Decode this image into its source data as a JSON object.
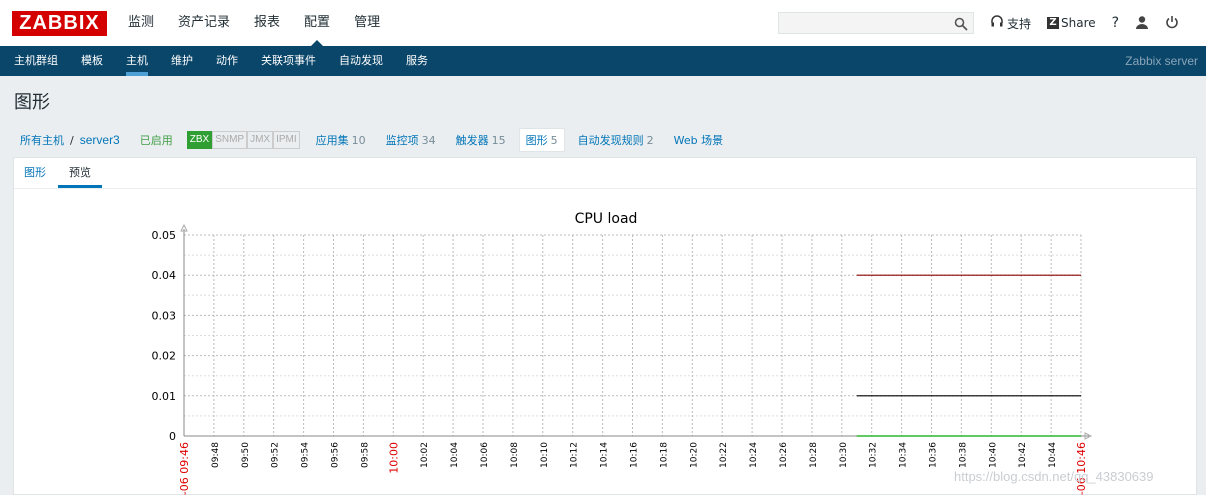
{
  "header": {
    "logo": "ZABBIX",
    "nav": [
      "监测",
      "资产记录",
      "报表",
      "配置",
      "管理"
    ],
    "active_nav": 3,
    "search_placeholder": "",
    "support_label": "支持",
    "share_label": "Share",
    "help_label": "?"
  },
  "subnav": {
    "items": [
      "主机群组",
      "模板",
      "主机",
      "维护",
      "动作",
      "关联项事件",
      "自动发现",
      "服务"
    ],
    "active": 2,
    "server_name": "Zabbix server"
  },
  "page_title": "图形",
  "breadcrumb": {
    "all_hosts": "所有主机",
    "separator": "/",
    "host": "server3",
    "status": "已启用",
    "badges": [
      "ZBX",
      "SNMP",
      "JMX",
      "IPMI"
    ],
    "sections": [
      {
        "label": "应用集",
        "count": "10"
      },
      {
        "label": "监控项",
        "count": "34"
      },
      {
        "label": "触发器",
        "count": "15"
      },
      {
        "label": "图形",
        "count": "5"
      },
      {
        "label": "自动发现规则",
        "count": "2"
      },
      {
        "label": "Web 场景",
        "count": ""
      }
    ]
  },
  "tabs": [
    "图形",
    "预览"
  ],
  "active_tab": 1,
  "chart_data": {
    "type": "line",
    "title": "CPU load",
    "ylim": [
      0,
      0.05
    ],
    "y_ticks": [
      "0.05",
      "0.04",
      "0.03",
      "0.02",
      "0.01",
      "0"
    ],
    "x_ticks": [
      "-06 09:46",
      "09:48",
      "09:50",
      "09:52",
      "09:54",
      "09:56",
      "09:58",
      "10:00",
      "10:02",
      "10:04",
      "10:06",
      "10:08",
      "10:10",
      "10:12",
      "10:14",
      "10:16",
      "10:18",
      "10:20",
      "10:22",
      "10:24",
      "10:26",
      "10:28",
      "10:30",
      "10:32",
      "10:34",
      "10:36",
      "10:38",
      "10:40",
      "10:42",
      "10:44",
      "-06 10:46"
    ],
    "x_ticks_highlight": [
      "-06 09:46",
      "10:00",
      "-06 10:46"
    ],
    "x_range": [
      "09:46",
      "10:46"
    ],
    "series": [
      {
        "values": [
          0.04,
          0.04
        ],
        "x": [
          "10:31",
          "10:46"
        ],
        "color": "#8b0000"
      },
      {
        "values": [
          0.01,
          0.01
        ],
        "x": [
          "10:31",
          "10:46"
        ],
        "color": "#000000"
      },
      {
        "values": [
          0,
          0
        ],
        "x": [
          "10:31",
          "10:46"
        ],
        "color": "#00aa00"
      }
    ],
    "grid": true
  },
  "watermark": "https://blog.csdn.net/qq_43830639",
  "colors": {
    "brand": "#d40000",
    "subbar": "#0a466a",
    "link": "#0275b8",
    "enabled": "#429e47",
    "badge_on": "#2f9f33"
  }
}
